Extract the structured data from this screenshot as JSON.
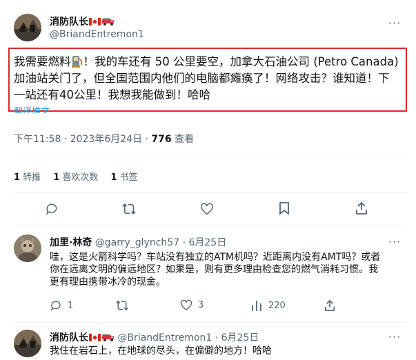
{
  "main_tweet": {
    "display_name": "消防队长",
    "handle": "@BriandEntremon1",
    "text_lines": [
      "我需要燃料",
      "！我的车还有 50 公里要空，加拿大石油公司 (Petro Canada)",
      "加油站关门了，但全国范围内他们的电脑都瘫痪了！网络攻击？谁知道！下",
      "一站还有40公里！我想我能做到！哈哈"
    ],
    "translate_label": "翻译推文",
    "timestamp": "下午11:58 · 2023年6月24日 · ",
    "views_count": "776",
    "views_label": " 查看",
    "stats": [
      {
        "count": "1",
        "label": "转推"
      },
      {
        "count": "1",
        "label": "喜欢次数"
      },
      {
        "count": "1",
        "label": "书签"
      }
    ]
  },
  "replies": [
    {
      "display_name": "加里·林奇",
      "handle_date": "@garry_glynch57 · 6月25日",
      "text_lines": [
        "哇，这是火箭科学吗？车站没有独立的ATM机吗？近距离内没有AMT吗？或者",
        "你在远离文明的偏远地区？如果是，则有更多理由检查您的燃气消耗习惯。我",
        "更有理由携带冰冷的现金。"
      ],
      "reply_count": "1",
      "retweet_count": "",
      "like_count": "3",
      "view_count": "220"
    },
    {
      "display_name": "消防队长",
      "handle_date": "@BriandEntremon1 · 6月25日",
      "text_lines": [
        "我住在岩石上，在地球的尽头，在偏僻的地方！哈哈"
      ]
    }
  ],
  "colors": {
    "highlight_border": "#e0252b",
    "link_blue": "#1d9bf0",
    "secondary_text": "#536471"
  },
  "icons": [
    "canada-flag-icon",
    "firetruck-icon",
    "fuel-pump-icon",
    "more-icon",
    "reply-icon",
    "retweet-icon",
    "like-icon",
    "bookmark-icon",
    "views-icon"
  ]
}
